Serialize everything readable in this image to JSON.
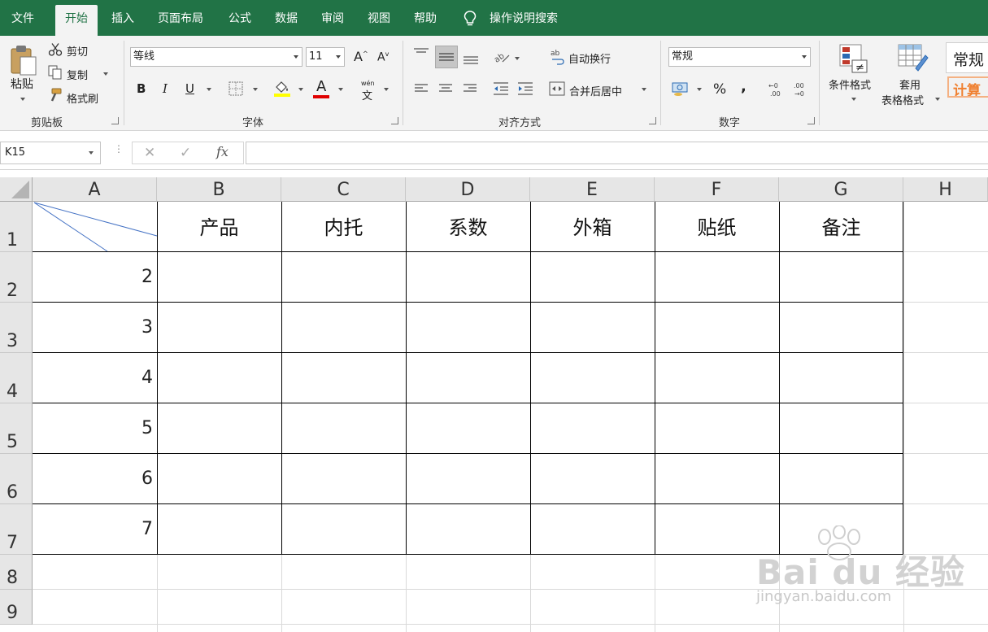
{
  "tabs": [
    "文件",
    "开始",
    "插入",
    "页面布局",
    "公式",
    "数据",
    "审阅",
    "视图",
    "帮助"
  ],
  "active_tab": "开始",
  "search_label": "操作说明搜索",
  "clipboard": {
    "paste": "粘贴",
    "cut": "剪切",
    "copy": "复制",
    "format_painter": "格式刷",
    "group": "剪贴板"
  },
  "font": {
    "name": "等线",
    "size": "11",
    "group": "字体",
    "bold": "B",
    "italic": "I",
    "underline": "U",
    "grow": "A",
    "shrink": "A",
    "color_letter": "A",
    "phonetic_top": "wén",
    "phonetic_char": "文"
  },
  "alignment": {
    "wrap": "自动换行",
    "merge": "合并后居中",
    "group": "对齐方式"
  },
  "number": {
    "format": "常规",
    "percent": "%",
    "comma": ",",
    "group": "数字"
  },
  "styles": {
    "conditional": "条件格式",
    "table_line1": "套用",
    "table_line2": "表格格式",
    "normal": "常规",
    "calc": "计算"
  },
  "formula_bar": {
    "name_box": "K15",
    "cancel": "✕",
    "enter": "✓",
    "fx": "fx",
    "formula": ""
  },
  "sheet": {
    "columns": [
      "A",
      "B",
      "C",
      "D",
      "E",
      "F",
      "G",
      "H"
    ],
    "rows": [
      "1",
      "2",
      "3",
      "4",
      "5",
      "6",
      "7",
      "8",
      "9"
    ],
    "header_cells": [
      "产品",
      "内托",
      "系数",
      "外箱",
      "贴纸",
      "备注"
    ],
    "a_values": [
      "2",
      "3",
      "4",
      "5",
      "6",
      "7"
    ]
  },
  "watermark": {
    "brand": "Bai du 经验",
    "url": "jingyan.baidu.com"
  },
  "colors": {
    "accent": "#217346",
    "ribbon": "#f3f3f3",
    "header": "#e6e6e6"
  }
}
